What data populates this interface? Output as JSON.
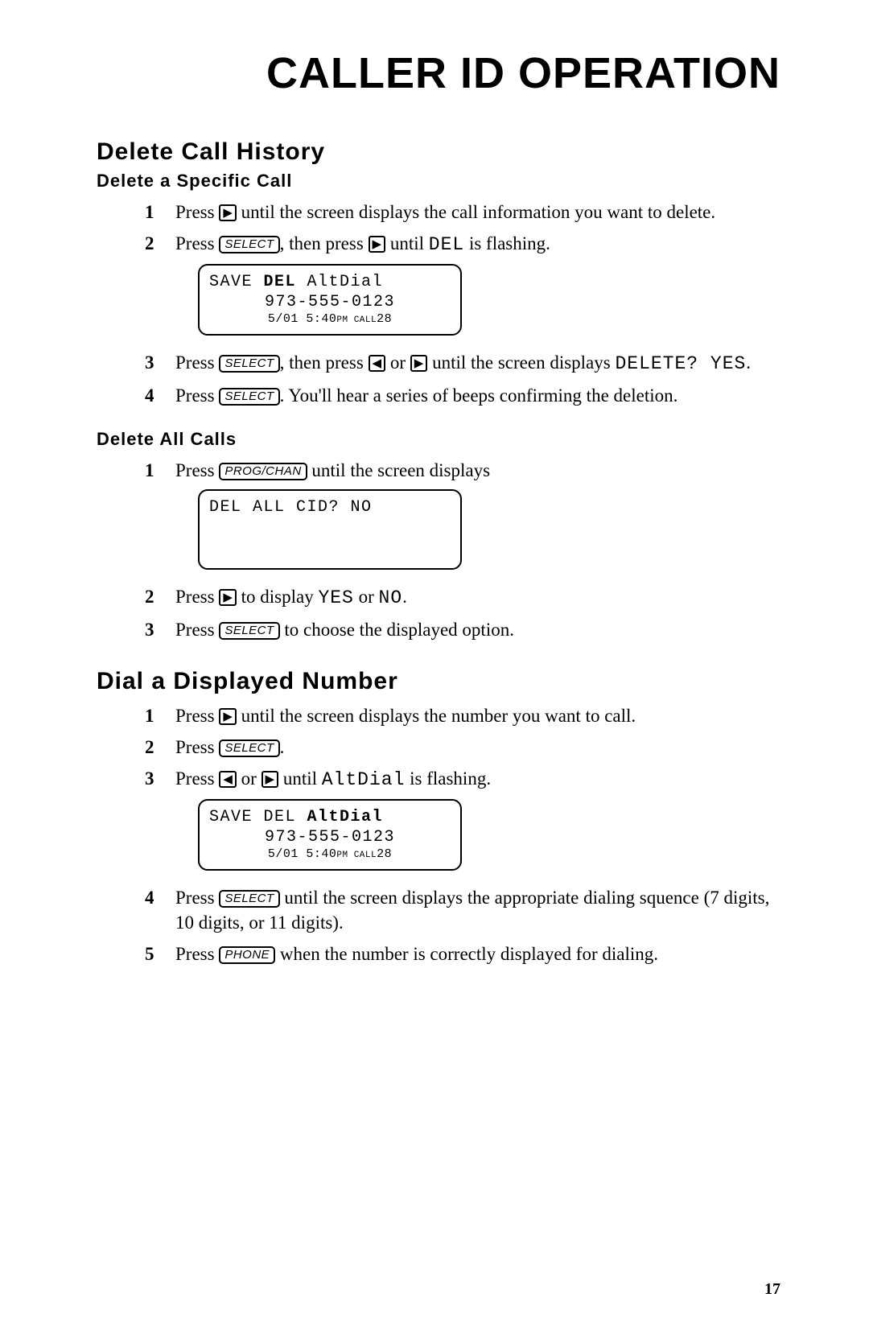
{
  "page": {
    "title": "CALLER ID OPERATION",
    "pageNumber": "17"
  },
  "buttons": {
    "select": "SELECT",
    "progchan": "PROG/CHAN",
    "phone": "PHONE",
    "right": "▶",
    "left": "◀"
  },
  "sections": {
    "deleteHistory": {
      "heading": "Delete Call History",
      "specific": {
        "heading": "Delete a Specific Call",
        "s1a": "Press ",
        "s1b": " until the screen displays the call information you want to delete.",
        "s2a": "Press ",
        "s2b": ", then press ",
        "s2c": " until ",
        "s2d": "DEL",
        "s2e": " is flashing.",
        "lcd": {
          "save": "SAVE ",
          "del": "DEL",
          "alt": " AltDial",
          "phone": "973-555-0123",
          "date": "5/01 5:40",
          "pm": "PM",
          "call": " CALL",
          "num": "28"
        },
        "s3a": "Press ",
        "s3b": ", then press ",
        "s3c": " or ",
        "s3d": " until the screen displays ",
        "s3e": "DELETE? YES",
        "s3f": ".",
        "s4a": "Press ",
        "s4b": ". You'll hear a series of beeps confirming the deletion."
      },
      "all": {
        "heading": "Delete All Calls",
        "s1a": "Press ",
        "s1b": " until the screen displays",
        "lcd": {
          "line": "DEL ALL CID? NO"
        },
        "s2a": "Press ",
        "s2b": " to display ",
        "s2c": "YES",
        "s2d": " or ",
        "s2e": "NO",
        "s2f": ".",
        "s3a": "Press ",
        "s3b": " to choose the displayed option."
      }
    },
    "dial": {
      "heading": "Dial a Displayed Number",
      "s1a": "Press ",
      "s1b": " until the screen displays the number you want to call.",
      "s2a": "Press ",
      "s2b": ".",
      "s3a": "Press ",
      "s3b": " or ",
      "s3c": " until ",
      "s3d": "AltDial",
      "s3e": " is flashing.",
      "lcd": {
        "save": "SAVE DEL ",
        "alt": "AltDial",
        "phone": "973-555-0123",
        "date": "5/01 5:40",
        "pm": "PM",
        "call": " CALL",
        "num": "28"
      },
      "s4a": "Press ",
      "s4b": " until the screen displays the appropriate dialing squence (7 digits, 10 digits, or 11 digits).",
      "s5a": "Press ",
      "s5b": " when the number is correctly displayed for dialing."
    }
  }
}
